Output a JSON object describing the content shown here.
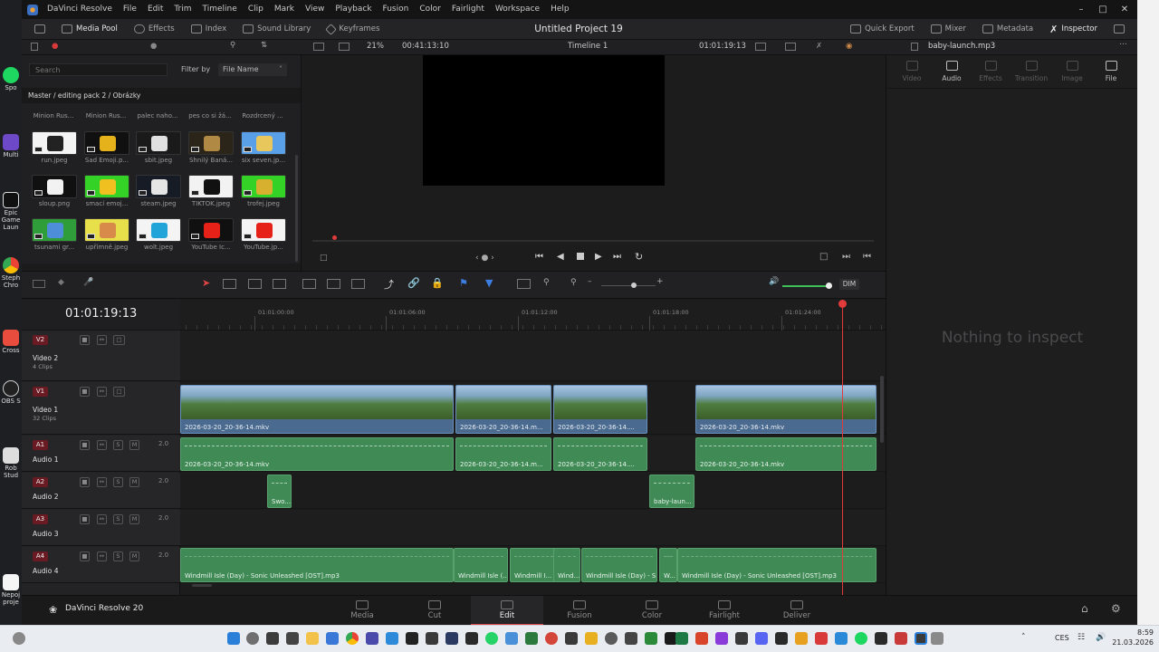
{
  "menu": {
    "app_name": "DaVinci Resolve",
    "items": [
      "File",
      "Edit",
      "Trim",
      "Timeline",
      "Clip",
      "Mark",
      "View",
      "Playback",
      "Fusion",
      "Color",
      "Fairlight",
      "Workspace",
      "Help"
    ]
  },
  "toolbar": {
    "media_pool": "Media Pool",
    "effects": "Effects",
    "index": "Index",
    "sound_library": "Sound Library",
    "keyframes": "Keyframes",
    "project_title": "Untitled Project 19",
    "quick_export": "Quick Export",
    "mixer": "Mixer",
    "metadata": "Metadata",
    "inspector": "Inspector"
  },
  "subbar": {
    "zoom": "21%",
    "source_timecode": "00:41:13:10",
    "timeline_name": "Timeline 1",
    "record_timecode": "01:01:19:13",
    "inspected_clip": "baby-launch.mp3"
  },
  "media_pool": {
    "search_placeholder": "Search",
    "filter_label": "Filter by",
    "filter_value": "File Name",
    "path": "Master / editing pack 2 / Obrázky",
    "top_row": [
      "Minion Rus...",
      "Minion Rus...",
      "palec naho...",
      "pes co si žá...",
      "Rozdrcený ..."
    ],
    "clips": [
      {
        "name": "run.jpeg",
        "bg": "#f4f4f4",
        "accent": "#222"
      },
      {
        "name": "Sad Emoji.p...",
        "bg": "#101010",
        "accent": "#e6b21c"
      },
      {
        "name": "sbit.jpeg",
        "bg": "#1a1a1a",
        "accent": "#e0e0e0"
      },
      {
        "name": "Shnilý Baná...",
        "bg": "#2b2418",
        "accent": "#b08a44"
      },
      {
        "name": "six seven.jp...",
        "bg": "#5aa0e8",
        "accent": "#e8c85c"
      },
      {
        "name": "sloup.png",
        "bg": "#101010",
        "accent": "#f2f2f2"
      },
      {
        "name": "smací emoj...",
        "bg": "#34d126",
        "accent": "#f0c020"
      },
      {
        "name": "steam.jpeg",
        "bg": "#161b26",
        "accent": "#e5e5e5"
      },
      {
        "name": "TIKTOK.jpeg",
        "bg": "#f2f2f2",
        "accent": "#111"
      },
      {
        "name": "trofej.jpeg",
        "bg": "#34d126",
        "accent": "#d8b030"
      },
      {
        "name": "tsunami gr...",
        "bg": "#2e9d3a",
        "accent": "#4e8ed8"
      },
      {
        "name": "upřímně.jpeg",
        "bg": "#e8e04a",
        "accent": "#d88a4a"
      },
      {
        "name": "wolt.jpeg",
        "bg": "#f4f4f4",
        "accent": "#22a4d8"
      },
      {
        "name": "YouTube Ic...",
        "bg": "#101010",
        "accent": "#e62117"
      },
      {
        "name": "YouTube.jp...",
        "bg": "#f4f4f4",
        "accent": "#e62117"
      }
    ]
  },
  "inspector": {
    "tabs": [
      "Video",
      "Audio",
      "Effects",
      "Transition",
      "Image",
      "File"
    ],
    "empty_message": "Nothing to inspect"
  },
  "timeline": {
    "timecode": "01:01:19:13",
    "ruler": [
      "01:01:00:00",
      "01:01:06:00",
      "01:01:12:00",
      "01:01:18:00",
      "01:01:24:00"
    ],
    "tracks": [
      {
        "badge": "V2",
        "name": "Video 2",
        "sub": "4 Clips"
      },
      {
        "badge": "V1",
        "name": "Video 1",
        "sub": "32 Clips"
      },
      {
        "badge": "A1",
        "name": "Audio 1",
        "vol": "2.0"
      },
      {
        "badge": "A2",
        "name": "Audio 2",
        "vol": "2.0"
      },
      {
        "badge": "A3",
        "name": "Audio 3",
        "vol": "2.0"
      },
      {
        "badge": "A4",
        "name": "Audio 4",
        "vol": "2.0"
      }
    ],
    "v1_clips": [
      "2026-03-20_20-36-14.mkv",
      "2026-03-20_20-36-14.m...",
      "2026-03-20_20-36-14....",
      "2026-03-20_20-36-14.mkv"
    ],
    "a1_clips": [
      "2026-03-20_20-36-14.mkv",
      "2026-03-20_20-36-14.m...",
      "2026-03-20_20-36-14....",
      "2026-03-20_20-36-14.mkv"
    ],
    "a2_clips": [
      "Swo...",
      "baby-laun..."
    ],
    "a4_clips": [
      "Windmill Isle (Day) - Sonic Unleashed [OST].mp3",
      "Windmill Isle (...",
      "Windmill I...",
      "Wind...",
      "Windmill Isle (Day) - S...",
      "W...",
      "Windmill Isle (Day) - Sonic Unleashed [OST].mp3"
    ],
    "dim_label": "DIM"
  },
  "pages": {
    "brand": "DaVinci Resolve 20",
    "items": [
      "Media",
      "Cut",
      "Edit",
      "Fusion",
      "Color",
      "Fairlight",
      "Deliver"
    ],
    "active": "Edit"
  },
  "desktop": {
    "labels": [
      "Spo",
      "Multi",
      "Epic Game Laun",
      "Steph Chro",
      "Cross",
      "OBS S",
      "Rob Stud",
      "Nepoj proje"
    ]
  },
  "taskbar": {
    "language": "CES",
    "time": "8:59",
    "date": "21.03.2026"
  }
}
